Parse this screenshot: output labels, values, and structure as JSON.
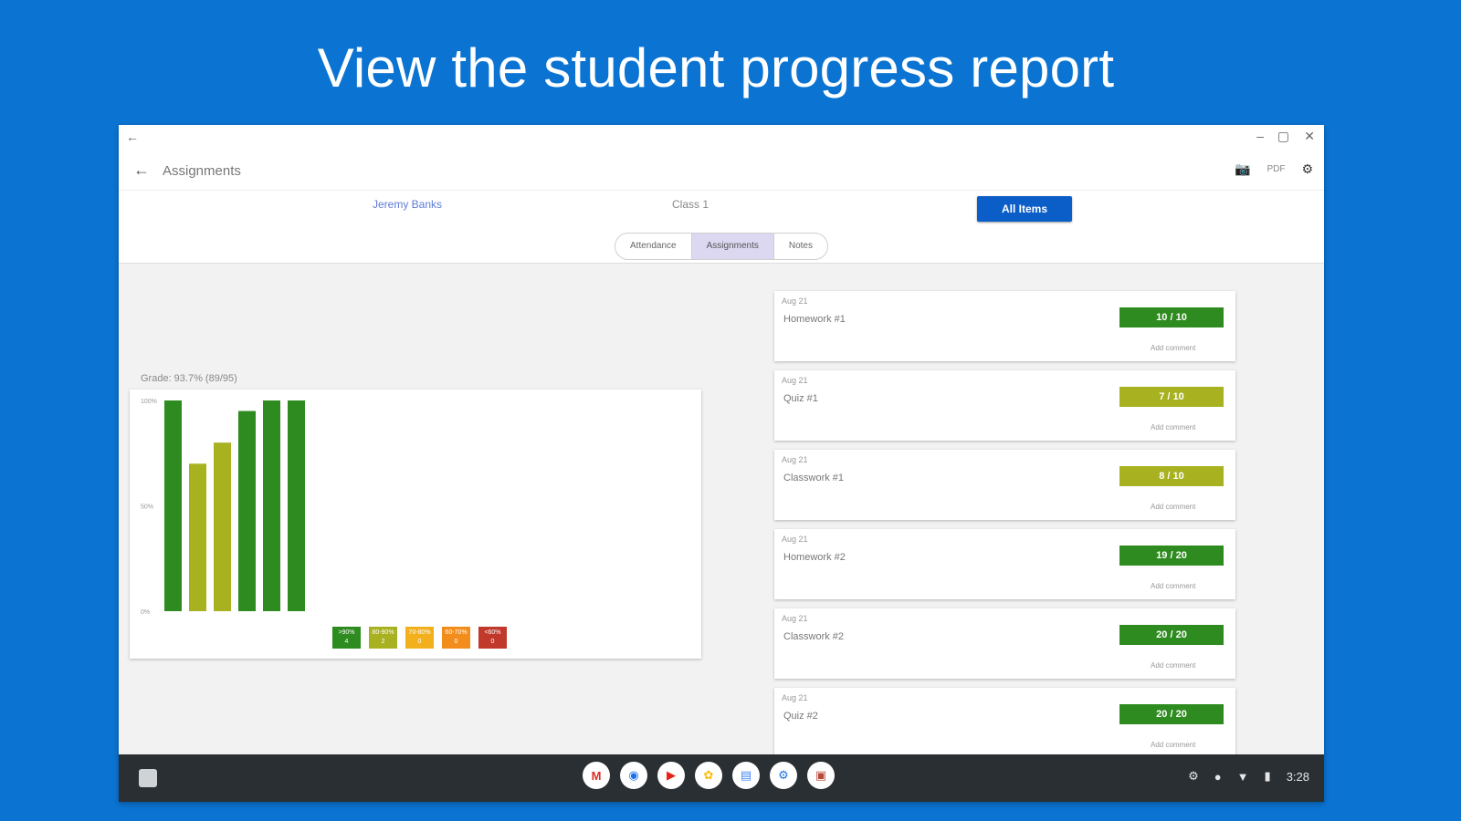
{
  "headline": "View the student progress report",
  "window": {
    "appbar_title": "Assignments",
    "pdf_label": "PDF"
  },
  "filter": {
    "student": "Jeremy Banks",
    "class_name": "Class 1",
    "all_items_label": "All Items",
    "segments": [
      "Attendance",
      "Assignments",
      "Notes"
    ],
    "active_segment": "Assignments"
  },
  "grade_label": "Grade: 93.7% (89/95)",
  "chart_data": {
    "type": "bar",
    "categories": [
      "Homework #1",
      "Quiz #1",
      "Classwork #1",
      "Homework #2",
      "Classwork #2",
      "Quiz #2"
    ],
    "values": [
      100,
      70,
      80,
      95,
      100,
      100
    ],
    "colors": [
      "#2e8b1f",
      "#a8b120",
      "#a8b120",
      "#2e8b1f",
      "#2e8b1f",
      "#2e8b1f"
    ],
    "y_ticks": [
      "100%",
      "50%",
      "0%"
    ],
    "ylim": [
      0,
      100
    ],
    "legend": [
      {
        "range": ">90%",
        "count": "4",
        "color": "#2e8b1f"
      },
      {
        "range": "80-90%",
        "count": "2",
        "color": "#a8b120"
      },
      {
        "range": "70-80%",
        "count": "0",
        "color": "#f2b01d"
      },
      {
        "range": "60-70%",
        "count": "0",
        "color": "#f28d1b"
      },
      {
        "range": "<60%",
        "count": "0",
        "color": "#c0392b"
      }
    ]
  },
  "assignments": [
    {
      "date": "Aug 21",
      "name": "Homework #1",
      "score": "10 / 10",
      "color": "#2e8b1f",
      "comment": "Add comment"
    },
    {
      "date": "Aug 21",
      "name": "Quiz #1",
      "score": "7 / 10",
      "color": "#a8b120",
      "comment": "Add comment"
    },
    {
      "date": "Aug 21",
      "name": "Classwork #1",
      "score": "8 / 10",
      "color": "#a8b120",
      "comment": "Add comment"
    },
    {
      "date": "Aug 21",
      "name": "Homework #2",
      "score": "19 / 20",
      "color": "#2e8b1f",
      "comment": "Add comment"
    },
    {
      "date": "Aug 21",
      "name": "Classwork #2",
      "score": "20 / 20",
      "color": "#2e8b1f",
      "comment": "Add comment"
    },
    {
      "date": "Aug 21",
      "name": "Quiz #2",
      "score": "20 / 20",
      "color": "#2e8b1f",
      "comment": "Add comment"
    }
  ],
  "shelf": {
    "apps": [
      {
        "icon": "gmail-icon",
        "glyph": "M",
        "color": "#d93025"
      },
      {
        "icon": "chrome-icon",
        "glyph": "◉",
        "color": "#1a73e8"
      },
      {
        "icon": "youtube-icon",
        "glyph": "▶",
        "color": "#e62117"
      },
      {
        "icon": "photos-icon",
        "glyph": "✿",
        "color": "#fbbc04"
      },
      {
        "icon": "docs-icon",
        "glyph": "▤",
        "color": "#4285f4"
      },
      {
        "icon": "settings-icon",
        "glyph": "⚙",
        "color": "#1a73e8"
      },
      {
        "icon": "gradebook-icon",
        "glyph": "▣",
        "color": "#b84a3a"
      }
    ],
    "time": "3:28"
  }
}
